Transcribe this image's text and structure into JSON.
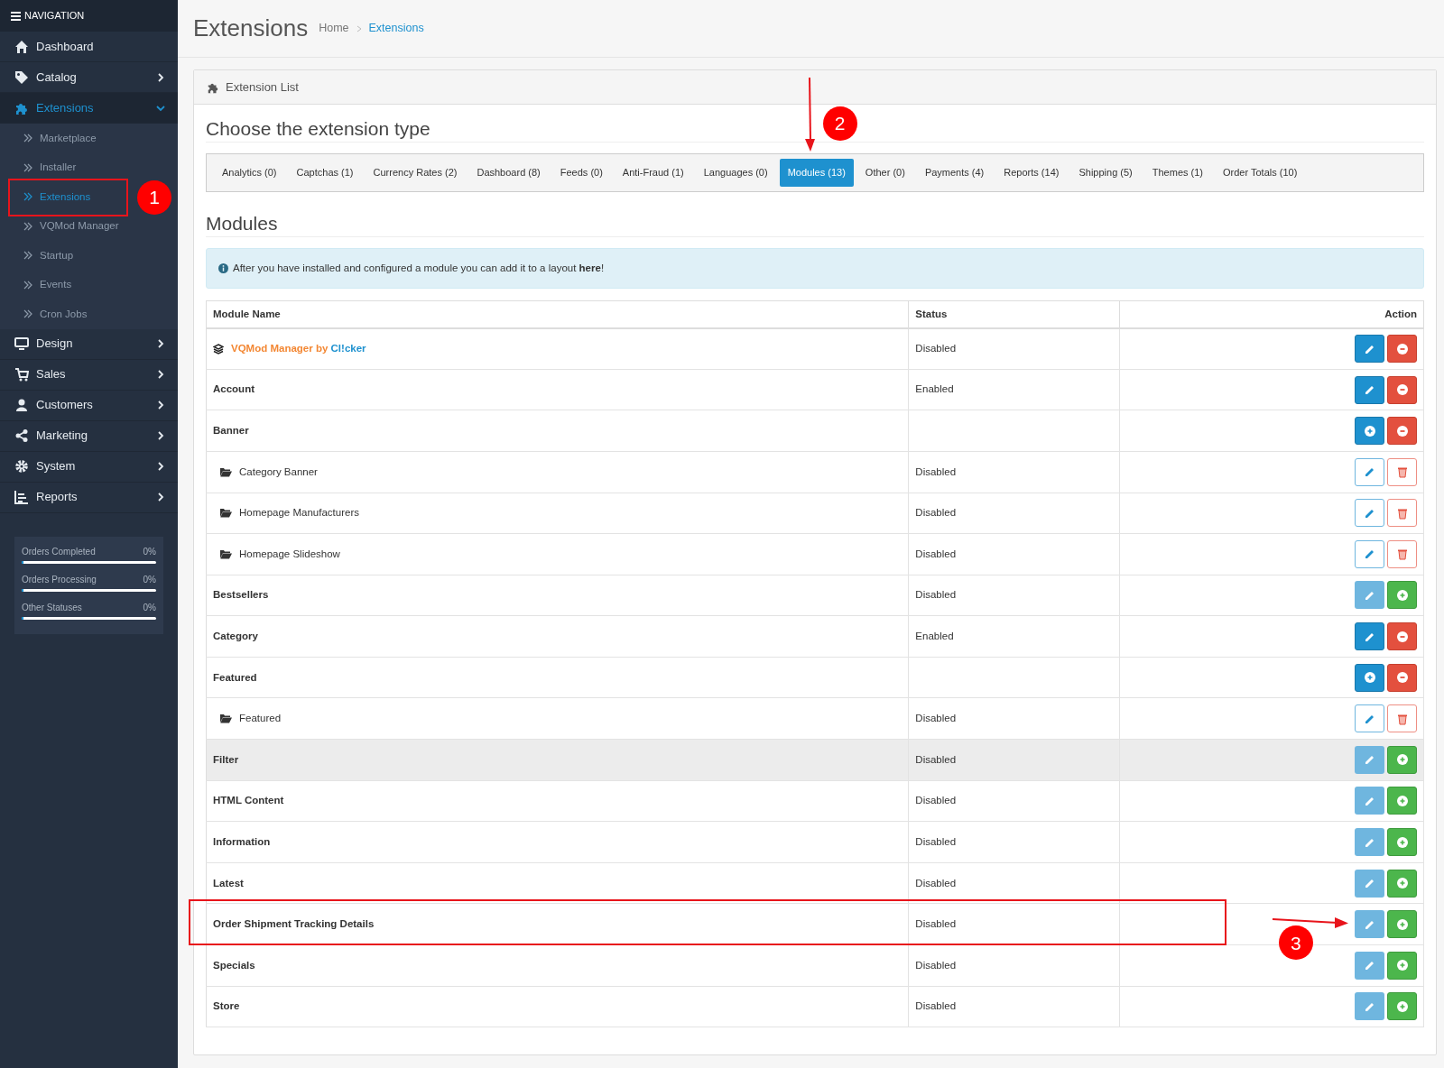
{
  "sidebar": {
    "header": "NAVIGATION",
    "items": [
      {
        "label": "Dashboard",
        "expanded": false
      },
      {
        "label": "Catalog",
        "expanded": false,
        "has_children": true
      },
      {
        "label": "Extensions",
        "expanded": true,
        "has_children": true,
        "children": [
          {
            "label": "Marketplace",
            "selected": false
          },
          {
            "label": "Installer",
            "selected": false
          },
          {
            "label": "Extensions",
            "selected": true,
            "annotation": "1"
          },
          {
            "label": "VQMod Manager",
            "selected": false
          },
          {
            "label": "Startup",
            "selected": false
          },
          {
            "label": "Events",
            "selected": false
          },
          {
            "label": "Cron Jobs",
            "selected": false
          }
        ]
      },
      {
        "label": "Design",
        "expanded": false,
        "has_children": true
      },
      {
        "label": "Sales",
        "expanded": false,
        "has_children": true
      },
      {
        "label": "Customers",
        "expanded": false,
        "has_children": true
      },
      {
        "label": "Marketing",
        "expanded": false,
        "has_children": true
      },
      {
        "label": "System",
        "expanded": false,
        "has_children": true
      },
      {
        "label": "Reports",
        "expanded": false,
        "has_children": true
      }
    ],
    "stats": [
      {
        "label": "Orders Completed",
        "reading": "0%",
        "level": 0
      },
      {
        "label": "Orders Processing",
        "reading": "0%",
        "level": 0
      },
      {
        "label": "Other Statuses",
        "reading": "0%",
        "level": 0
      }
    ]
  },
  "page": {
    "title": "Extensions",
    "breadcrumb": [
      "Home",
      "Extensions"
    ]
  },
  "panel": {
    "title": "Extension List",
    "heading": "Choose the extension type",
    "tabs": [
      {
        "label": "Analytics (0)",
        "selected": false
      },
      {
        "label": "Captchas (1)",
        "selected": false
      },
      {
        "label": "Currency Rates (2)",
        "selected": false
      },
      {
        "label": "Dashboard (8)",
        "selected": false
      },
      {
        "label": "Feeds (0)",
        "selected": false
      },
      {
        "label": "Anti-Fraud (1)",
        "selected": false
      },
      {
        "label": "Languages (0)",
        "selected": false
      },
      {
        "label": "Modules (13)",
        "selected": true,
        "annotation": "2"
      },
      {
        "label": "Other (0)",
        "selected": false
      },
      {
        "label": "Payments (4)",
        "selected": false
      },
      {
        "label": "Reports (14)",
        "selected": false
      },
      {
        "label": "Shipping (5)",
        "selected": false
      },
      {
        "label": "Themes (1)",
        "selected": false
      },
      {
        "label": "Order Totals (10)",
        "selected": false
      }
    ],
    "section": "Modules",
    "alert": "After you have installed and configured a module you can add it to a layout **here**!",
    "table": {
      "columns": [
        "Module Name",
        "Status",
        "Action"
      ],
      "rows": [
        {
          "kind": "branded",
          "name": "VQMod Manager by",
          "author": "Cl!cker",
          "status": "Disabled",
          "highlighted": false,
          "actions": [
            {
              "kind": "edit"
            },
            {
              "kind": "uninstall"
            }
          ]
        },
        {
          "kind": "module",
          "name": "Account",
          "status": "Enabled",
          "highlighted": false,
          "actions": [
            {
              "kind": "edit"
            },
            {
              "kind": "uninstall"
            }
          ]
        },
        {
          "kind": "module",
          "name": "Banner",
          "highlighted": false,
          "actions": [
            {
              "kind": "add"
            },
            {
              "kind": "uninstall"
            }
          ]
        },
        {
          "kind": "instance",
          "name": "Category Banner",
          "status": "Disabled",
          "highlighted": false,
          "actions": [
            {
              "kind": "edit-outline"
            },
            {
              "kind": "delete"
            }
          ]
        },
        {
          "kind": "instance",
          "name": "Homepage Manufacturers",
          "status": "Disabled",
          "highlighted": false,
          "actions": [
            {
              "kind": "edit-outline"
            },
            {
              "kind": "delete"
            }
          ]
        },
        {
          "kind": "instance",
          "name": "Homepage Slideshow",
          "status": "Disabled",
          "highlighted": false,
          "actions": [
            {
              "kind": "edit-outline"
            },
            {
              "kind": "delete"
            }
          ]
        },
        {
          "kind": "module",
          "name": "Bestsellers",
          "status": "Disabled",
          "highlighted": false,
          "actions": [
            {
              "kind": "edit-disabled"
            },
            {
              "kind": "install"
            }
          ]
        },
        {
          "kind": "module",
          "name": "Category",
          "status": "Enabled",
          "highlighted": false,
          "actions": [
            {
              "kind": "edit"
            },
            {
              "kind": "uninstall"
            }
          ]
        },
        {
          "kind": "module",
          "name": "Featured",
          "highlighted": false,
          "actions": [
            {
              "kind": "add"
            },
            {
              "kind": "uninstall"
            }
          ]
        },
        {
          "kind": "instance",
          "name": "Featured",
          "status": "Disabled",
          "highlighted": false,
          "actions": [
            {
              "kind": "edit-outline"
            },
            {
              "kind": "delete"
            }
          ]
        },
        {
          "kind": "module",
          "name": "Filter",
          "status": "Disabled",
          "highlighted": true,
          "actions": [
            {
              "kind": "edit-disabled"
            },
            {
              "kind": "install"
            }
          ]
        },
        {
          "kind": "module",
          "name": "HTML Content",
          "status": "Disabled",
          "highlighted": false,
          "actions": [
            {
              "kind": "edit-disabled"
            },
            {
              "kind": "install"
            }
          ]
        },
        {
          "kind": "module",
          "name": "Information",
          "status": "Disabled",
          "highlighted": false,
          "actions": [
            {
              "kind": "edit-disabled"
            },
            {
              "kind": "install"
            }
          ]
        },
        {
          "kind": "module",
          "name": "Latest",
          "status": "Disabled",
          "highlighted": false,
          "actions": [
            {
              "kind": "edit-disabled"
            },
            {
              "kind": "install"
            }
          ]
        },
        {
          "kind": "module",
          "name": "Order Shipment Tracking Details",
          "status": "Disabled",
          "highlighted": false,
          "annotation": "3",
          "actions": [
            {
              "kind": "edit-disabled"
            },
            {
              "kind": "install"
            }
          ]
        },
        {
          "kind": "module",
          "name": "Specials",
          "status": "Disabled",
          "highlighted": false,
          "actions": [
            {
              "kind": "edit-disabled"
            },
            {
              "kind": "install"
            }
          ]
        },
        {
          "kind": "module",
          "name": "Store",
          "status": "Disabled",
          "highlighted": false,
          "actions": [
            {
              "kind": "edit-disabled"
            },
            {
              "kind": "install"
            }
          ]
        }
      ]
    }
  }
}
